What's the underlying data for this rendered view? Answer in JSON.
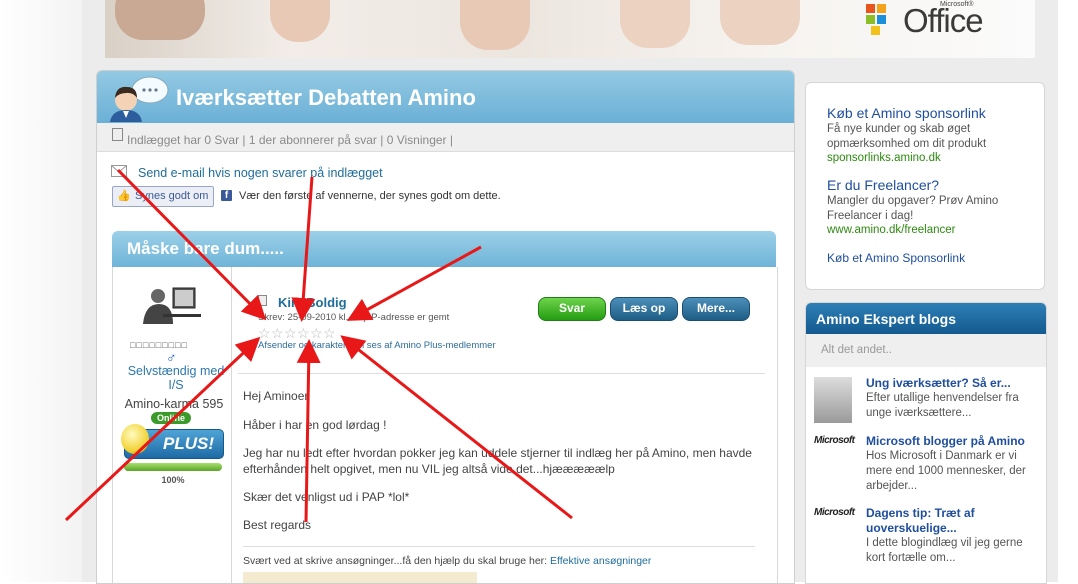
{
  "banner": {
    "logo_text": "Office",
    "logo_ms": "Microsoft®"
  },
  "main": {
    "title": "Iværksætter Debatten Amino",
    "stats": "Indlægget har 0 Svar | 1 der abonnerer på svar | 0 Visninger |",
    "email_link": "Send e-mail hvis nogen svarer på indlægget",
    "like_button": "Synes godt om",
    "like_text": "Vær den første af vennerne, der synes godt om dette."
  },
  "post": {
    "title": "Måske bare dum.....",
    "user": {
      "username": "Selvstændig med I/S",
      "karma": "Amino-karma 595",
      "online": "Online",
      "badge": "PLUS!",
      "progress_percent": 100,
      "progress_label": "100%"
    },
    "author": "Kim Boldig",
    "meta": "Skrev: 25-09-2010 kl. 11 | IP-adresse er gemt",
    "rating_note": "Afsender og karakter kan ses af Amino Plus-medlemmer",
    "buttons": {
      "reply": "Svar",
      "read": "Læs op",
      "more": "Mere..."
    },
    "paragraphs": [
      "Hej Aminoer",
      "Håber i har en god lørdag !",
      "Jeg har nu ledt efter hvordan pokker jeg kan uddele stjerner til indlæg her på Amino, men havde efterhånden helt opgivet, men nu VIL jeg altså vide det...hjææææælp",
      "Skær det venligst ud i PAP *lol*",
      "Best regards"
    ],
    "signature_text": "Svært ved at skrive ansøgninger...få den hjælp du skal bruge her:",
    "signature_link": "Effektive ansøgninger"
  },
  "sponsor": {
    "ads": [
      {
        "title": "Køb et Amino sponsorlink",
        "desc": "Få nye kunder og skab øget opmærksomhed om dit produkt",
        "url": "sponsorlinks.amino.dk"
      },
      {
        "title": "Er du Freelancer?",
        "desc": "Mangler du opgaver? Prøv Amino Freelancer i dag!",
        "url": "www.amino.dk/freelancer"
      }
    ],
    "bottom_link": "Køb et Amino Sponsorlink"
  },
  "blogs": {
    "title": "Amino Ekspert blogs",
    "subtitle": "Alt det andet..",
    "items": [
      {
        "title": "Ung iværksætter? Så er...",
        "desc": "Efter utallige henvendelser fra unge iværksættere..."
      },
      {
        "title": "Microsoft blogger på Amino",
        "desc": "Hos Microsoft i Danmark er vi mere end 1000 mennesker, der arbejder...",
        "logo": "Microsoft"
      },
      {
        "title": "Dagens tip: Træt af uoverskuelige...",
        "desc": "I dette blogindlæg vil jeg gerne kort fortælle om...",
        "logo": "Microsoft"
      }
    ]
  },
  "colors": {
    "accent": "#6bb0d6",
    "link": "#1f6d9a",
    "green": "#239d11",
    "annotation": "#e81818"
  }
}
